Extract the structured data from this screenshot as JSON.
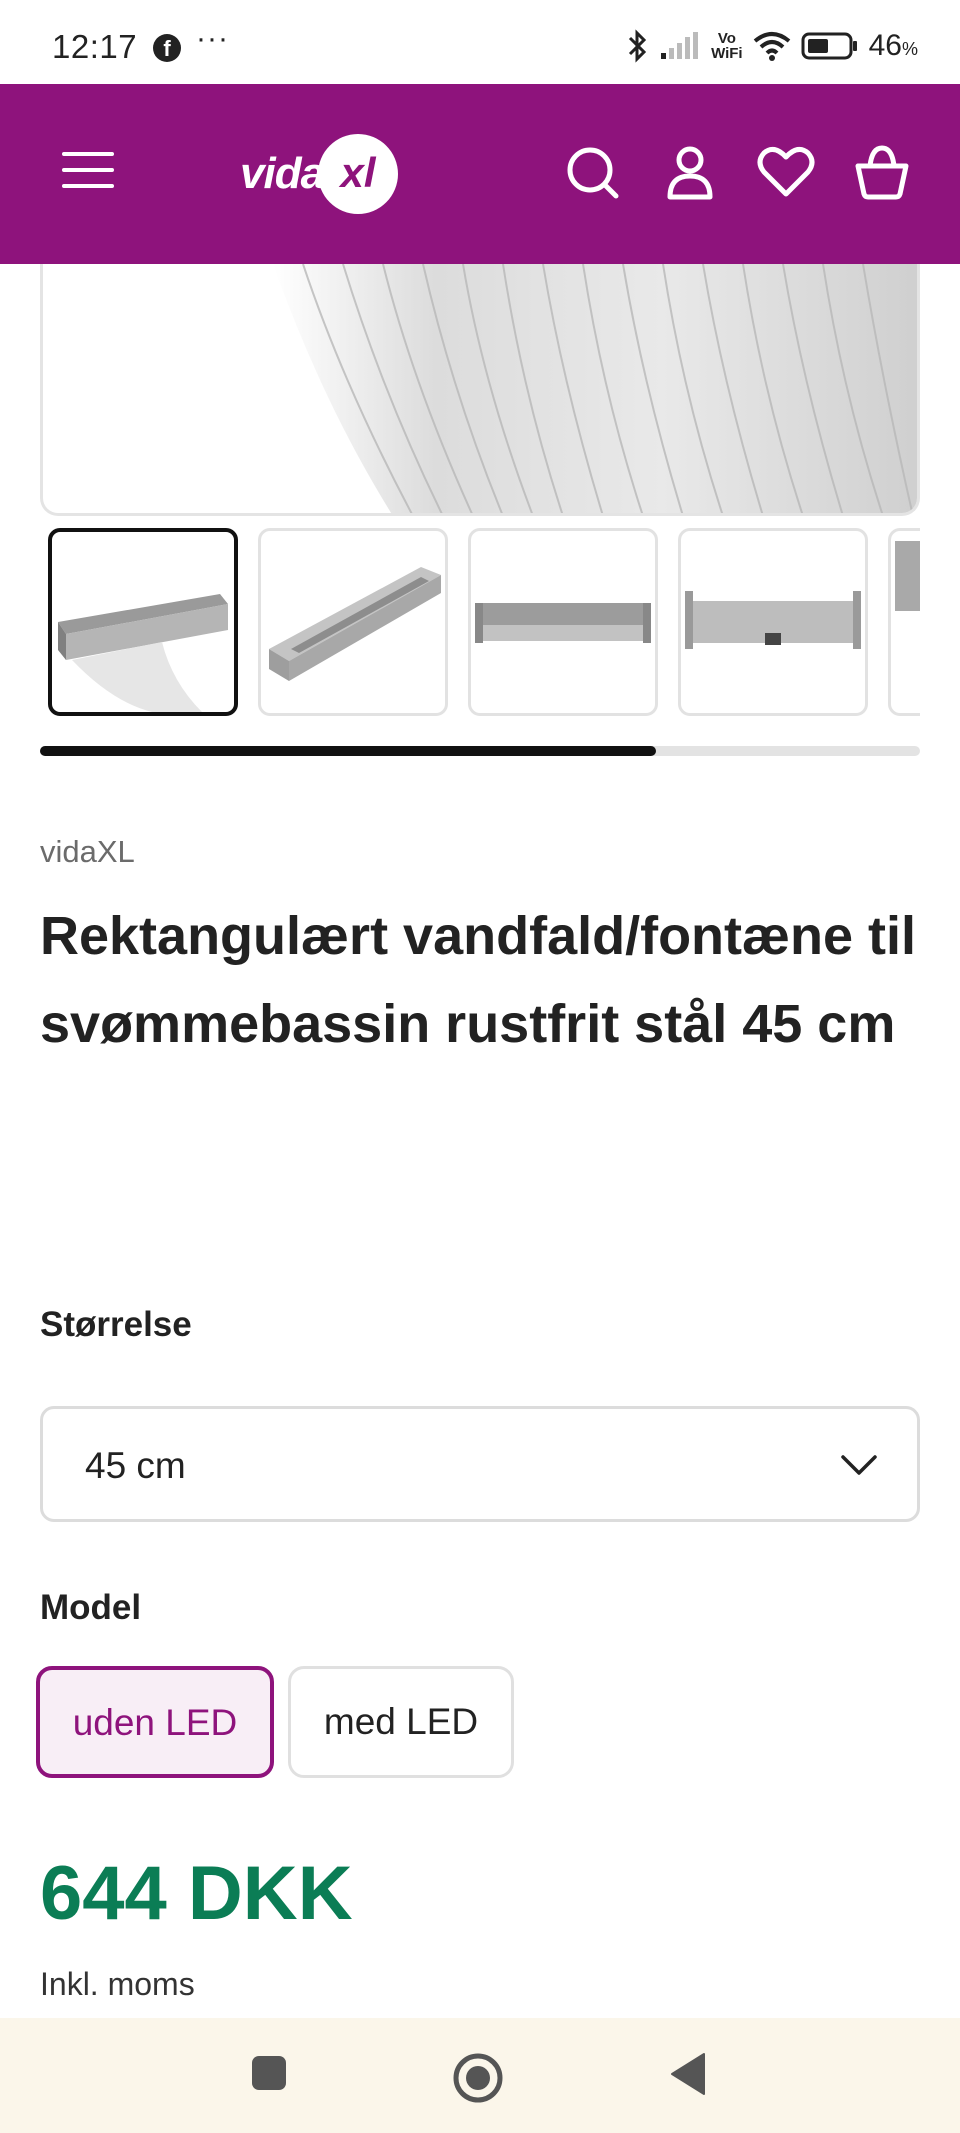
{
  "status_bar": {
    "time": "12:17",
    "battery": "46",
    "battery_unit": "%",
    "wifi_label_top": "Vo",
    "wifi_label_bottom": "WiFi",
    "more_dots": "···"
  },
  "header": {
    "logo_text": "vida",
    "logo_badge": "xl",
    "accent_color": "#8e137c",
    "icons": [
      "menu-icon",
      "search-icon",
      "account-icon",
      "wishlist-heart-icon",
      "cart-basket-icon"
    ]
  },
  "gallery": {
    "thumbnail_count_visible": 5,
    "active_index": 0,
    "scroll_progress": 0.7
  },
  "product": {
    "brand": "vidaXL",
    "title": "Rektangulært vandfald/fontæne til svømmebassin rustfrit stål 45 cm",
    "size_label": "Størrelse",
    "size_value": "45 cm",
    "model_label": "Model",
    "model_options": [
      {
        "label": "uden LED",
        "selected": true
      },
      {
        "label": "med LED",
        "selected": false
      }
    ],
    "price": "644 DKK",
    "price_color": "#0b7d55",
    "vat_note": "Inkl. moms"
  },
  "nav_bar": {
    "buttons": [
      "recents-square-icon",
      "home-circle-icon",
      "back-triangle-icon"
    ]
  }
}
